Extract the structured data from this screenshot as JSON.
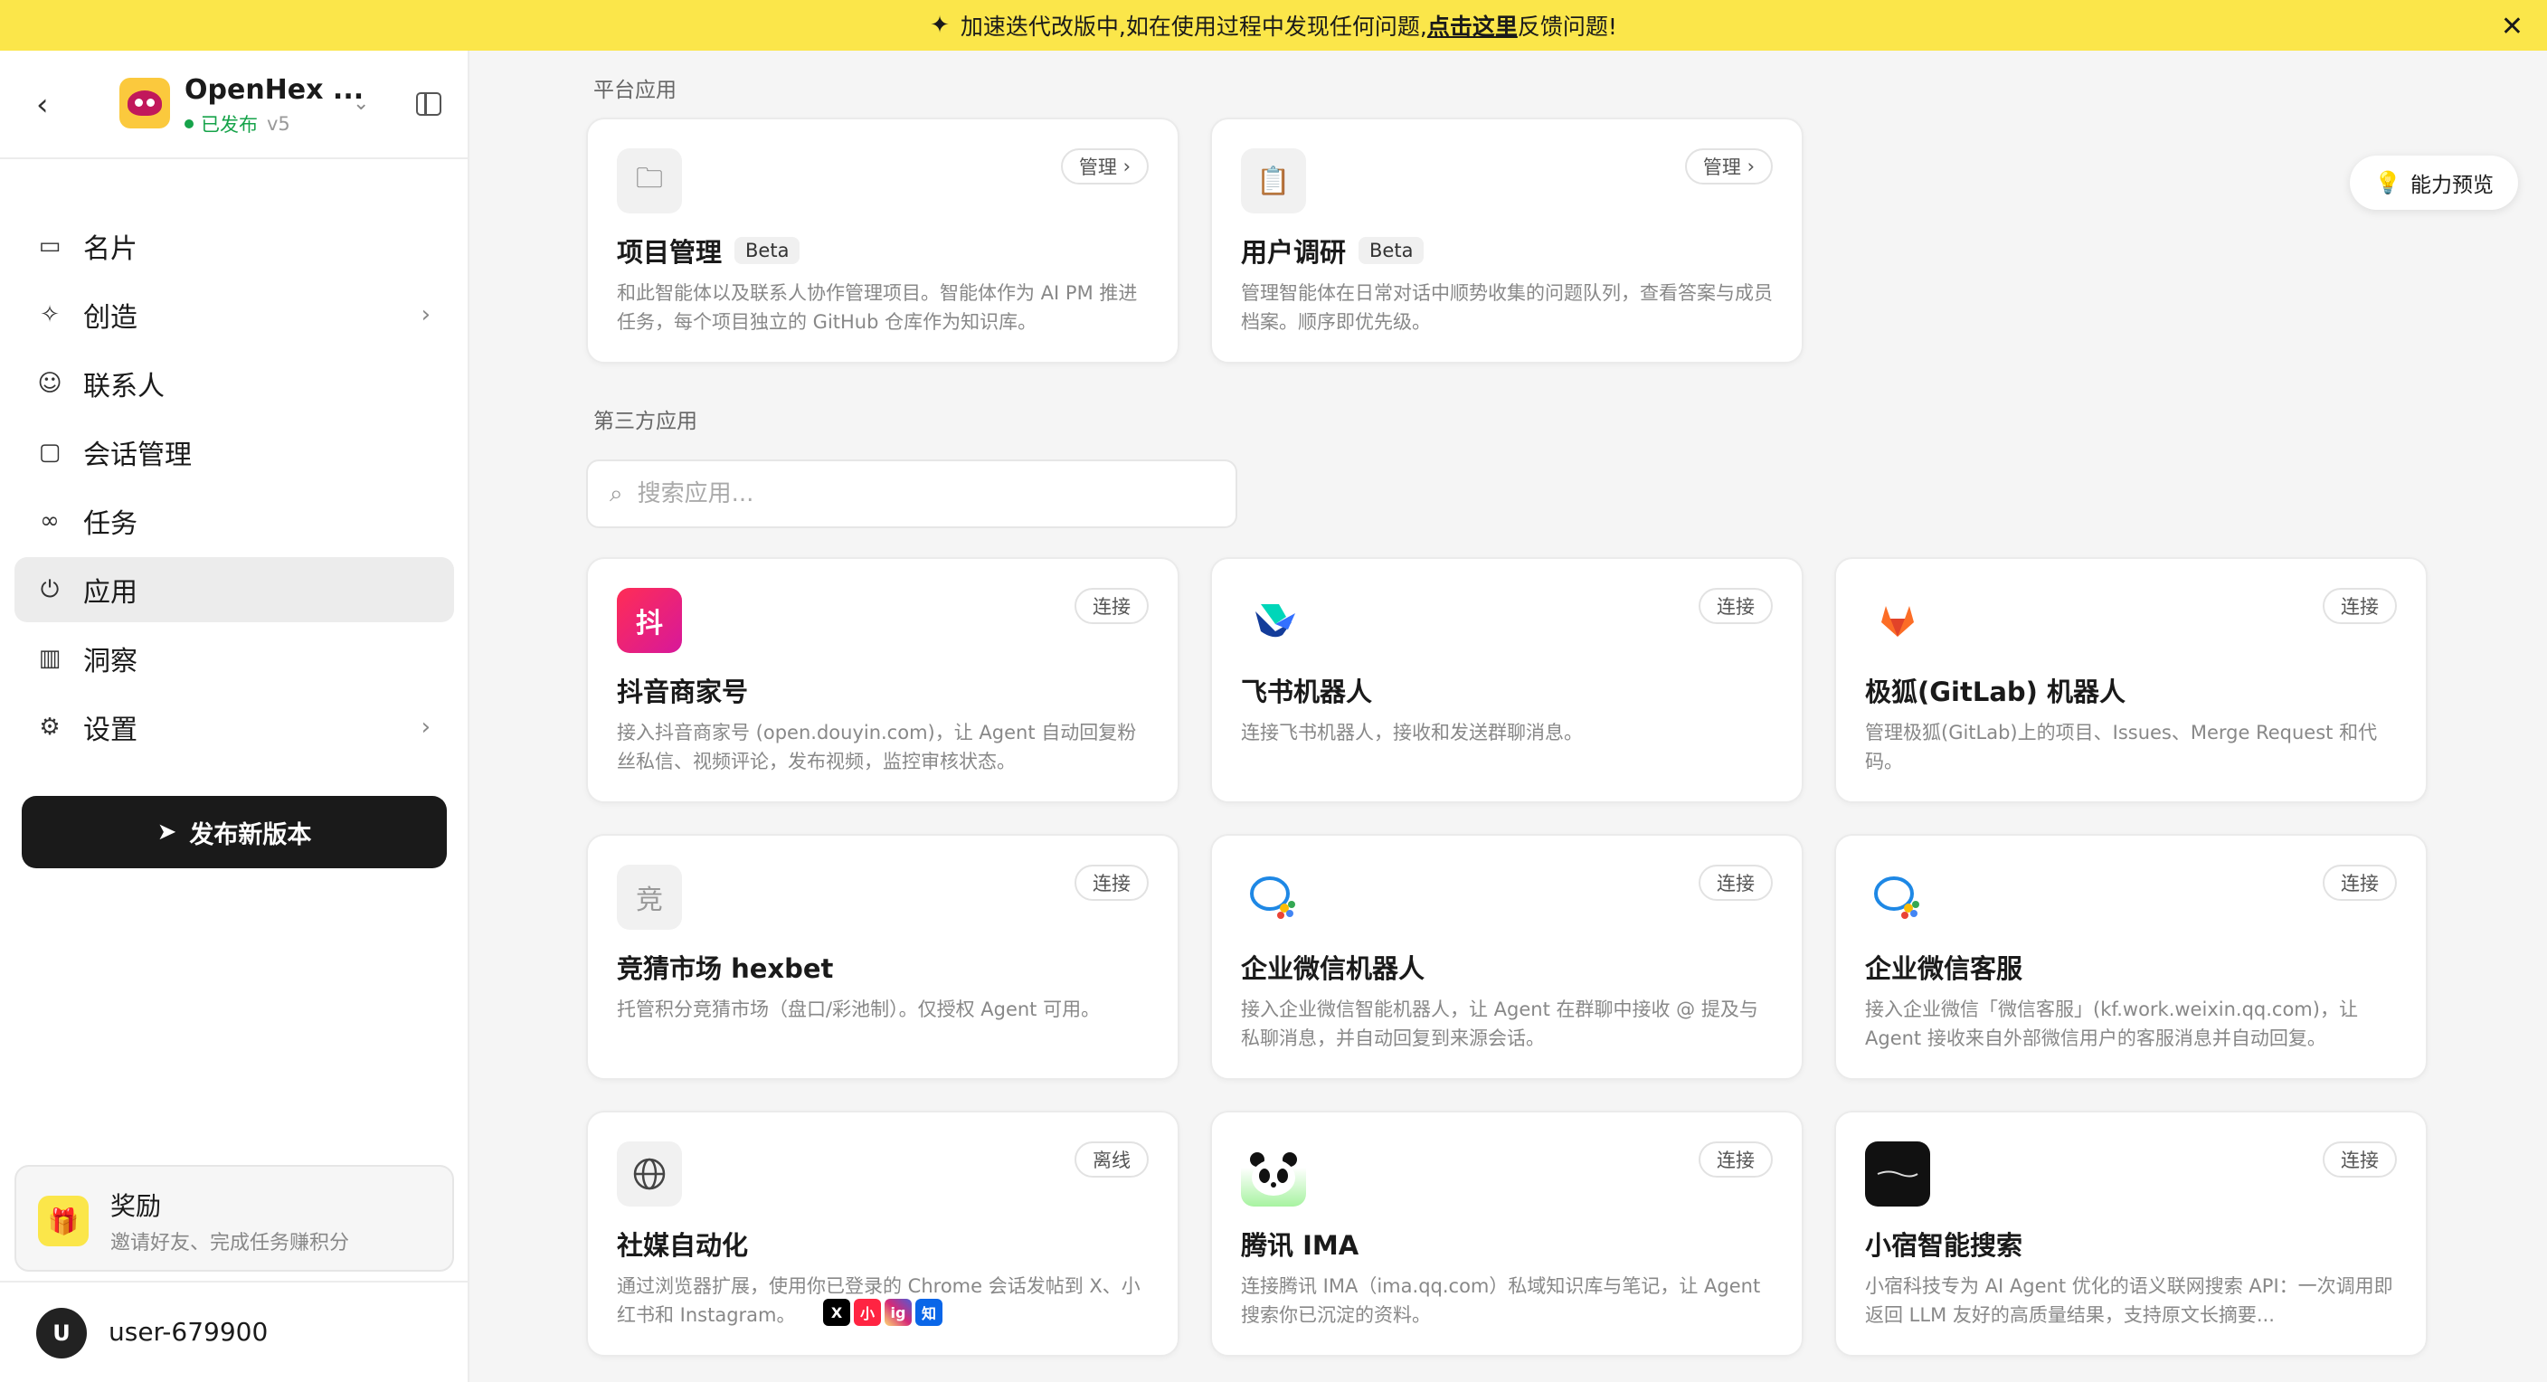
{
  "banner": {
    "text_before": "加速迭代改版中,如在使用过程中发现任何问题,",
    "link_text": "点击这里",
    "text_after": "反馈问题!"
  },
  "sidebar": {
    "agent_name": "OpenHex ...",
    "status": "已发布",
    "version": "v5",
    "items": [
      {
        "label": "名片",
        "icon": "id-card-icon"
      },
      {
        "label": "创造",
        "icon": "sparkle-icon",
        "has_chevron": true
      },
      {
        "label": "联系人",
        "icon": "contact-icon"
      },
      {
        "label": "会话管理",
        "icon": "chat-icon"
      },
      {
        "label": "任务",
        "icon": "task-icon"
      },
      {
        "label": "应用",
        "icon": "plug-icon",
        "active": true
      },
      {
        "label": "洞察",
        "icon": "bar-chart-icon"
      },
      {
        "label": "设置",
        "icon": "gear-icon",
        "has_chevron": true
      }
    ],
    "publish_label": "发布新版本",
    "reward": {
      "title": "奖励",
      "subtitle": "邀请好友、完成任务赚积分"
    },
    "user": {
      "initial": "U",
      "name": "user-679900"
    }
  },
  "main": {
    "platform_label": "平台应用",
    "third_party_label": "第三方应用",
    "preview_label": "能力预览",
    "search_placeholder": "搜索应用...",
    "platform_apps": [
      {
        "title": "项目管理",
        "badge": "Beta",
        "button": "管理",
        "desc": "和此智能体以及联系人协作管理项目。智能体作为 AI PM 推进任务，每个项目独立的 GitHub 仓库作为知识库。",
        "icon": "folder-icon"
      },
      {
        "title": "用户调研",
        "badge": "Beta",
        "button": "管理",
        "desc": "管理智能体在日常对话中顺势收集的问题队列，查看答案与成员档案。顺序即优先级。",
        "icon": "clipboard-icon"
      }
    ],
    "third_party_apps": [
      {
        "title": "抖音商家号",
        "button": "连接",
        "desc": "接入抖音商家号 (open.douyin.com)，让 Agent 自动回复粉丝私信、视频评论，发布视频，监控审核状态。",
        "icon": "douyin-icon",
        "icon_text": "抖",
        "icon_bg": "#f0324a"
      },
      {
        "title": "飞书机器人",
        "button": "连接",
        "desc": "连接飞书机器人，接收和发送群聊消息。",
        "icon": "feishu-icon",
        "icon_text": "",
        "icon_bg": "#ffffff"
      },
      {
        "title": "极狐(GitLab) 机器人",
        "button": "连接",
        "desc": "管理极狐(GitLab)上的项目、Issues、Merge Request 和代码。",
        "icon": "gitlab-icon",
        "icon_text": "",
        "icon_bg": "#ffffff"
      },
      {
        "title": "竞猜市场 hexbet",
        "button": "连接",
        "desc": "托管积分竞猜市场（盘口/彩池制）。仅授权 Agent 可用。",
        "icon": "hexbet-icon",
        "icon_text": "竞",
        "icon_bg": "#f1f1f1"
      },
      {
        "title": "企业微信机器人",
        "button": "连接",
        "desc": "接入企业微信智能机器人，让 Agent 在群聊中接收 @ 提及与私聊消息，并自动回复到来源会话。",
        "icon": "wecom-icon",
        "icon_text": "",
        "icon_bg": "#ffffff"
      },
      {
        "title": "企业微信客服",
        "button": "连接",
        "desc": "接入企业微信「微信客服」(kf.work.weixin.qq.com)，让 Agent 接收来自外部微信用户的客服消息并自动回复。",
        "icon": "wecom-kf-icon",
        "icon_text": "",
        "icon_bg": "#ffffff"
      },
      {
        "title": "社媒自动化",
        "button": "离线",
        "desc": "通过浏览器扩展，使用你已登录的 Chrome 会话发帖到 X、小红书和 Instagram。",
        "icon": "globe-icon",
        "icon_text": "",
        "icon_bg": "#f1f1f1"
      },
      {
        "title": "腾讯 IMA",
        "button": "连接",
        "desc": "连接腾讯 IMA（ima.qq.com）私域知识库与笔记，让 Agent 搜索你已沉淀的资料。",
        "icon": "panda-icon",
        "icon_text": "",
        "icon_bg": "#ffffff"
      },
      {
        "title": "小宿智能搜索",
        "button": "连接",
        "desc": "小宿科技专为 AI Agent 优化的语义联网搜索 API：一次调用即返回 LLM 友好的高质量结果，支持原文长摘要...",
        "icon": "xiaosu-icon",
        "icon_text": "",
        "icon_bg": "#111111"
      }
    ],
    "social_badges": [
      {
        "text": "X",
        "color": "#000000"
      },
      {
        "text": "小",
        "color": "#ff2442"
      },
      {
        "text": "ig",
        "color": "#d62976"
      },
      {
        "text": "知",
        "color": "#0a66e8"
      }
    ]
  }
}
